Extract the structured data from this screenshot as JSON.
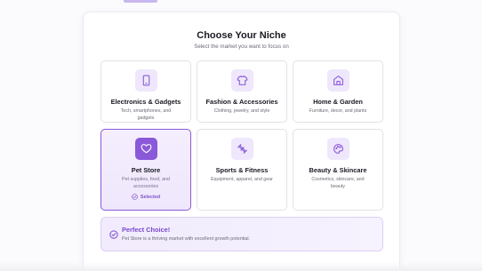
{
  "header": {
    "title": "Choose Your Niche",
    "subtitle": "Select the market you want to focus on"
  },
  "niches": [
    {
      "title": "Electronics & Gadgets",
      "desc": "Tech, smartphones, and gadgets",
      "icon": "smartphone-icon",
      "selected": false
    },
    {
      "title": "Fashion & Accessories",
      "desc": "Clothing, jewelry, and style",
      "icon": "shirt-icon",
      "selected": false
    },
    {
      "title": "Home & Garden",
      "desc": "Furniture, decor, and plants",
      "icon": "home-icon",
      "selected": false
    },
    {
      "title": "Pet Store",
      "desc": "Pet supplies, food, and accessories",
      "icon": "heart-icon",
      "selected": true
    },
    {
      "title": "Sports & Fitness",
      "desc": "Equipment, apparel, and gear",
      "icon": "dumbbell-icon",
      "selected": false
    },
    {
      "title": "Beauty & Skincare",
      "desc": "Cosmetics, skincare, and beauty",
      "icon": "palette-icon",
      "selected": false
    }
  ],
  "selected_label": "Selected",
  "banner": {
    "title": "Perfect Choice!",
    "text": "Pet Store is a thriving market with excellent growth potential."
  },
  "colors": {
    "accent": "#8a59d9",
    "accent_light": "#efe7fc",
    "banner_title": "#7a48cf"
  }
}
